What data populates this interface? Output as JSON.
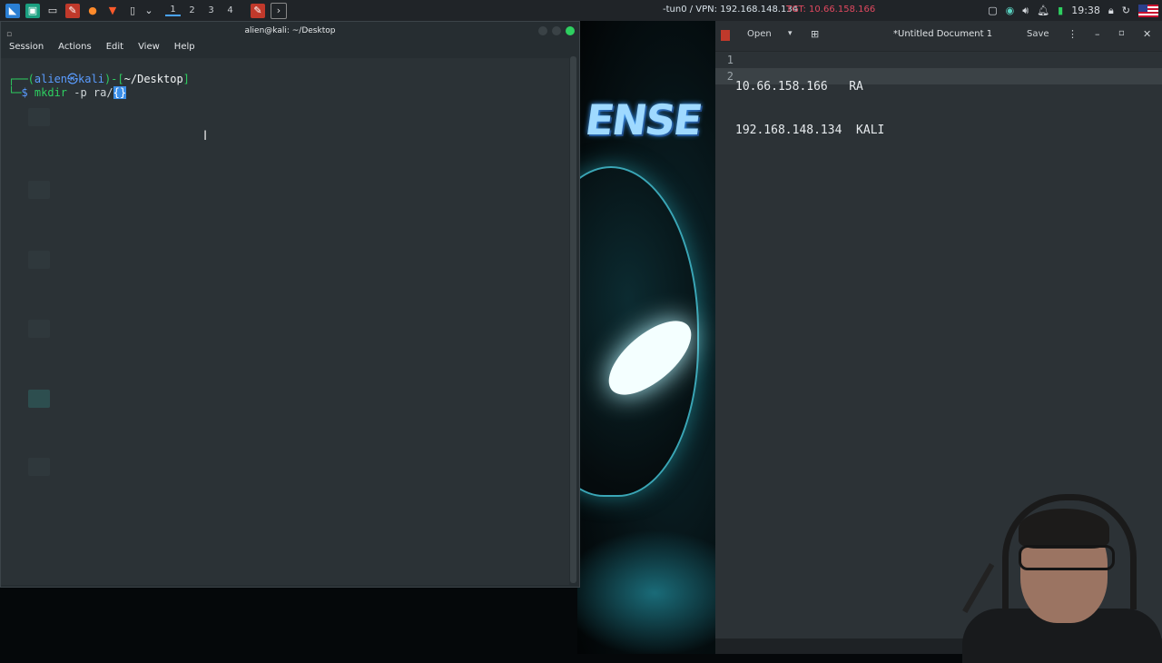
{
  "taskbar": {
    "workspaces": [
      "1",
      "2",
      "3",
      "4"
    ],
    "vpn_text": "-tun0 / VPN: 192.168.148.134",
    "tgt_text": "TGT: 10.66.158.166",
    "clock": "19:38",
    "colors": {
      "vpn": "#d9e3ea",
      "tgt": "#e0485f"
    }
  },
  "terminal": {
    "title": "alien@kali: ~/Desktop",
    "menu": [
      "Session",
      "Actions",
      "Edit",
      "View",
      "Help"
    ],
    "prompt_user": "alien",
    "prompt_at": "㉿",
    "prompt_host": "kali",
    "prompt_dir": "~/Desktop",
    "command_bin": "mkdir",
    "command_args": " -p ra/",
    "command_selected": "{}"
  },
  "editor": {
    "open_label": "Open",
    "title": "*Untitled Document 1",
    "save_label": "Save",
    "line_numbers": [
      "1",
      "2"
    ],
    "lines": [
      "10.66.158.166   RA",
      "192.168.148.134  KALI"
    ]
  },
  "wallpaper": {
    "logo_text": "ENSE"
  }
}
